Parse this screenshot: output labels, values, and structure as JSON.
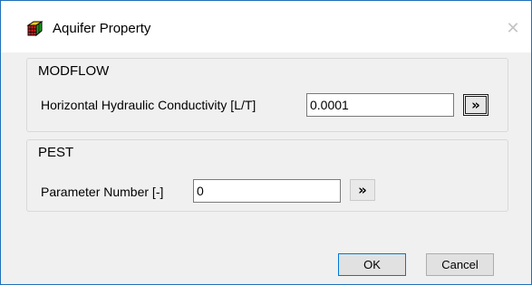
{
  "window": {
    "title": "Aquifer Property",
    "app_icon": "colored-cube-icon",
    "close_icon": "close-icon",
    "close_glyph": "✕"
  },
  "modflow": {
    "group_title": "MODFLOW",
    "field_label": "Horizontal Hydraulic Conductivity [L/T]",
    "field_value": "0.0001",
    "arrow_button_icon": "double-chevron-right-icon",
    "arrow_glyph": "»"
  },
  "pest": {
    "group_title": "PEST",
    "field_label": "Parameter Number [-]",
    "field_value": "0",
    "arrow_button_icon": "double-chevron-right-icon",
    "arrow_glyph": "»"
  },
  "buttons": {
    "ok_label": "OK",
    "cancel_label": "Cancel"
  },
  "colors": {
    "window_border": "#1f6fb8",
    "ok_border": "#0078d7",
    "dialog_bg": "#f0f0f0"
  }
}
